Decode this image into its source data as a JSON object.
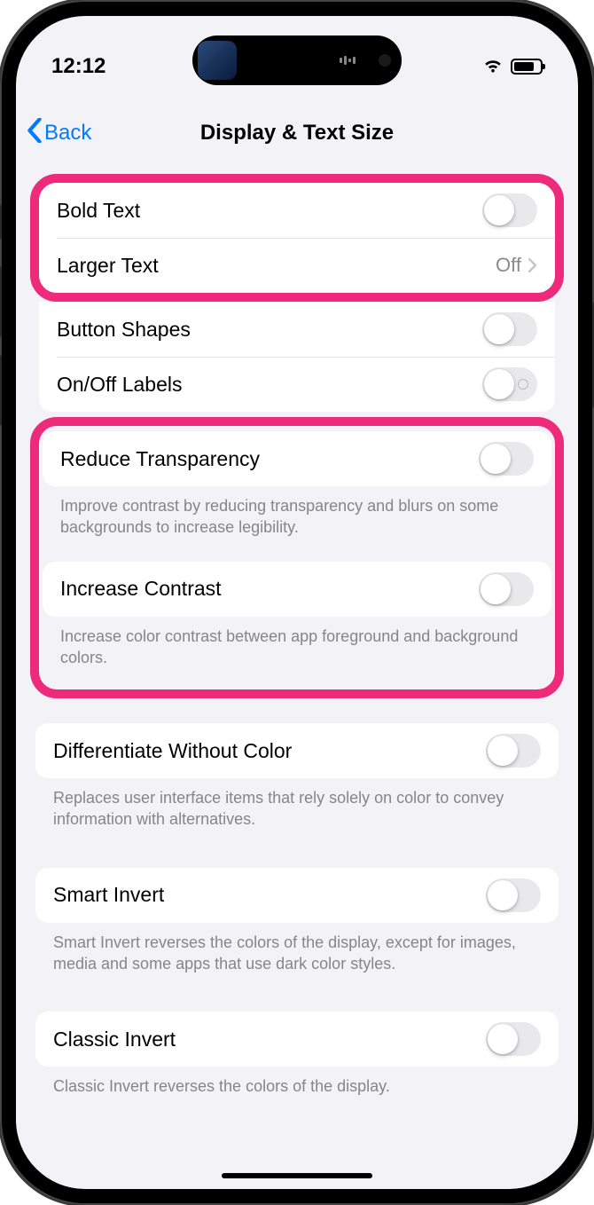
{
  "status": {
    "time": "12:12"
  },
  "nav": {
    "back": "Back",
    "title": "Display & Text Size"
  },
  "rows": {
    "bold_text": "Bold Text",
    "larger_text": "Larger Text",
    "larger_text_value": "Off",
    "button_shapes": "Button Shapes",
    "on_off_labels": "On/Off Labels",
    "reduce_transparency": "Reduce Transparency",
    "reduce_transparency_footer": "Improve contrast by reducing transparency and blurs on some backgrounds to increase legibility.",
    "increase_contrast": "Increase Contrast",
    "increase_contrast_footer": "Increase color contrast between app foreground and background colors.",
    "diff_without_color": "Differentiate Without Color",
    "diff_without_color_footer": "Replaces user interface items that rely solely on color to convey information with alternatives.",
    "smart_invert": "Smart Invert",
    "smart_invert_footer": "Smart Invert reverses the colors of the display, except for images, media and some apps that use dark color styles.",
    "classic_invert": "Classic Invert",
    "classic_invert_footer": "Classic Invert reverses the colors of the display."
  }
}
